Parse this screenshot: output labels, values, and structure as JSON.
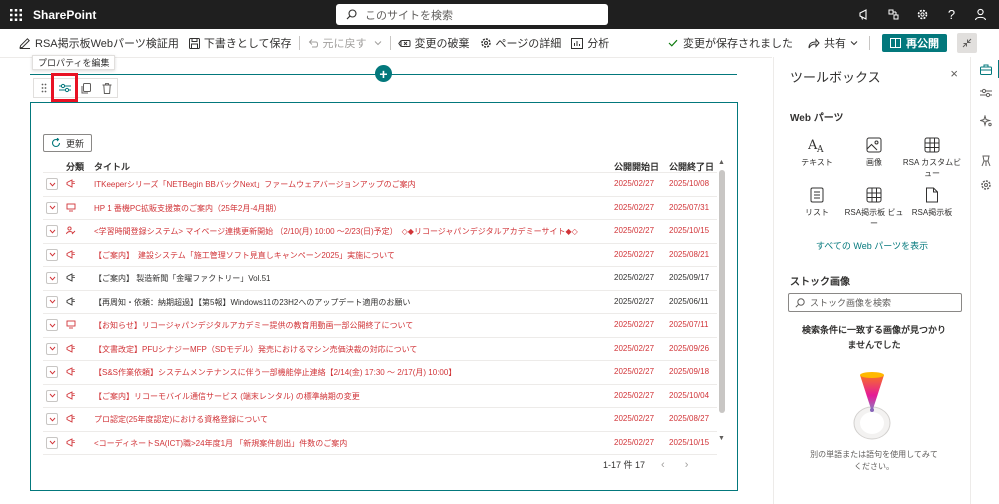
{
  "suitebar": {
    "brand": "SharePoint",
    "search_placeholder": "このサイトを検索",
    "icons": [
      "megaphone-icon",
      "share-network-icon",
      "gear-icon",
      "help-icon",
      "person-icon"
    ],
    "help_glyph": "?"
  },
  "commandbar": {
    "page_name": "RSA掲示板Webパーツ検証用",
    "save_draft": "下書きとして保存",
    "undo": "元に戻す",
    "discard": "変更の破棄",
    "page_details": "ページの詳細",
    "analytics": "分析",
    "saved_status": "変更が保存されました",
    "share": "共有",
    "republish": "再公開"
  },
  "canvas": {
    "tooltip": "プロパティを編集",
    "add_glyph": "+"
  },
  "webpart": {
    "refresh_label": "更新",
    "columns": {
      "category": "分類",
      "title": "タイトル",
      "start": "公開開始日",
      "end": "公開終了日"
    },
    "rows": [
      {
        "icon": "megaphone-icon",
        "title": "ITKeeperシリーズ「NETBegin BBバックNext」ファームウェアバージョンアップのご案内",
        "start": "2025/02/27",
        "end": "2025/10/08",
        "color": "red"
      },
      {
        "icon": "monitor-icon",
        "title": "HP 1 番機PC拡販支援策のご案内（25年2月-4月期）",
        "start": "2025/02/27",
        "end": "2025/07/31",
        "color": "red"
      },
      {
        "icon": "person-edit-icon",
        "title": "<学習時間登録システム> マイページ連携更新開始 （2/10(月) 10:00 ～2/23(日)予定）　◇◆リコージャパンデジタルアカデミーサイト◆◇",
        "start": "2025/02/27",
        "end": "2025/10/15",
        "color": "red"
      },
      {
        "icon": "megaphone-icon",
        "title": "【ご案内】　建設システム「施工管理ソフト見直しキャンペーン2025」実施について",
        "start": "2025/02/27",
        "end": "2025/08/21",
        "color": "red"
      },
      {
        "icon": "megaphone-icon",
        "title": "【ご案内】 製造新聞「金曜ファクトリー」Vol.51",
        "start": "2025/02/27",
        "end": "2025/09/17",
        "color": "dark"
      },
      {
        "icon": "megaphone-icon",
        "title": "【再周知・依頼：納期超過】【第5報】Windows11の23H2へのアップデート適用のお願い",
        "start": "2025/02/27",
        "end": "2025/06/11",
        "color": "dark"
      },
      {
        "icon": "monitor-icon",
        "title": "【お知らせ】リコージャパンデジタルアカデミー提供の教育用動画一部公開終了について",
        "start": "2025/02/27",
        "end": "2025/07/11",
        "color": "red"
      },
      {
        "icon": "megaphone-icon",
        "title": "【文書改定】PFUシナジーMFP（SDモデル）発売におけるマシン売価決裁の対応について",
        "start": "2025/02/27",
        "end": "2025/09/26",
        "color": "red"
      },
      {
        "icon": "megaphone-icon",
        "title": "【S&S作業依頼】システムメンテナンスに伴う一部機能停止連絡【2/14(金) 17:30 ～ 2/17(月) 10:00】",
        "start": "2025/02/27",
        "end": "2025/09/18",
        "color": "red"
      },
      {
        "icon": "megaphone-icon",
        "title": "【ご案内】リコーモバイル通信サービス (端末レンタル) の標準納期の変更",
        "start": "2025/02/27",
        "end": "2025/10/04",
        "color": "red"
      },
      {
        "icon": "megaphone-icon",
        "title": "プロ認定(25年度認定)における資格登録について",
        "start": "2025/02/27",
        "end": "2025/08/27",
        "color": "red"
      },
      {
        "icon": "megaphone-icon",
        "title": "<コーディネートSA(ICT)職>24年度1月 「新規案件創出」件数のご案内",
        "start": "2025/02/27",
        "end": "2025/10/15",
        "color": "red"
      }
    ],
    "pager": "1-17 件 17",
    "prev_glyph": "‹",
    "next_glyph": "›",
    "scroll_up": "▲",
    "scroll_down": "▼"
  },
  "toolbox": {
    "title": "ツールボックス",
    "close_glyph": "×",
    "webparts_heading": "Web パーツ",
    "webparts": [
      {
        "label": "テキスト",
        "icon": "text-icon"
      },
      {
        "label": "画像",
        "icon": "image-icon"
      },
      {
        "label": "RSA カスタムビュー",
        "icon": "table-icon"
      },
      {
        "label": "リスト",
        "icon": "list-icon"
      },
      {
        "label": "RSA掲示板 ビュー",
        "icon": "table-icon"
      },
      {
        "label": "RSA掲示板",
        "icon": "document-icon"
      }
    ],
    "see_all": "すべての Web パーツを表示",
    "stock_heading": "ストック画像",
    "stock_search_placeholder": "ストック画像を検索",
    "no_result_line1": "検索条件に一致する画像が見つかり",
    "no_result_line2": "ませんでした",
    "hint_line1": "別の単語または語句を使用してみて",
    "hint_line2": "ください。"
  },
  "rail": {
    "items": [
      "toolbox-icon",
      "sliders-icon",
      "sparkle-icon",
      "design-icon",
      "gear-icon"
    ]
  },
  "colors": {
    "accent": "#03787c",
    "suitebar": "#1f1f1f",
    "highlight": "#e81123",
    "item_red": "#d13438"
  }
}
